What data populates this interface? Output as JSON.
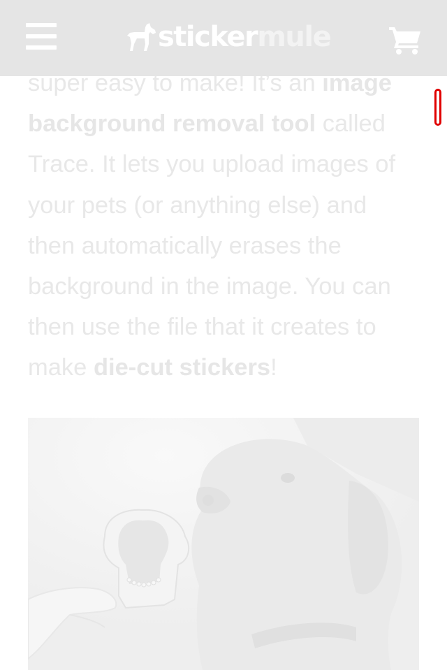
{
  "header": {
    "logo_text_sticker": "sticker",
    "logo_text_mule": "mule",
    "menu_icon": "hamburger-menu-icon",
    "cart_icon": "shopping-cart-icon",
    "logo_icon": "mule-logo-icon",
    "background_color": "#e5e5e5"
  },
  "article": {
    "line1_plain": "super easy to make! It’s an ",
    "line1_bold": "image",
    "line2_bold": "background removal tool",
    "line2_plain": " called",
    "line3": "Trace. It lets you upload images of",
    "line4": "your pets (or anything else) and",
    "line5": "then automatically erases the",
    "line6": "background in the image. You can",
    "line7": "then use the file that it creates to",
    "line8_plain": "make ",
    "line8_link": "die-cut stickers",
    "line8_end": "!"
  },
  "photo": {
    "subject": "dog-with-die-cut-sticker-photo"
  },
  "scroll_marker": {
    "accent_color": "#e00000"
  }
}
